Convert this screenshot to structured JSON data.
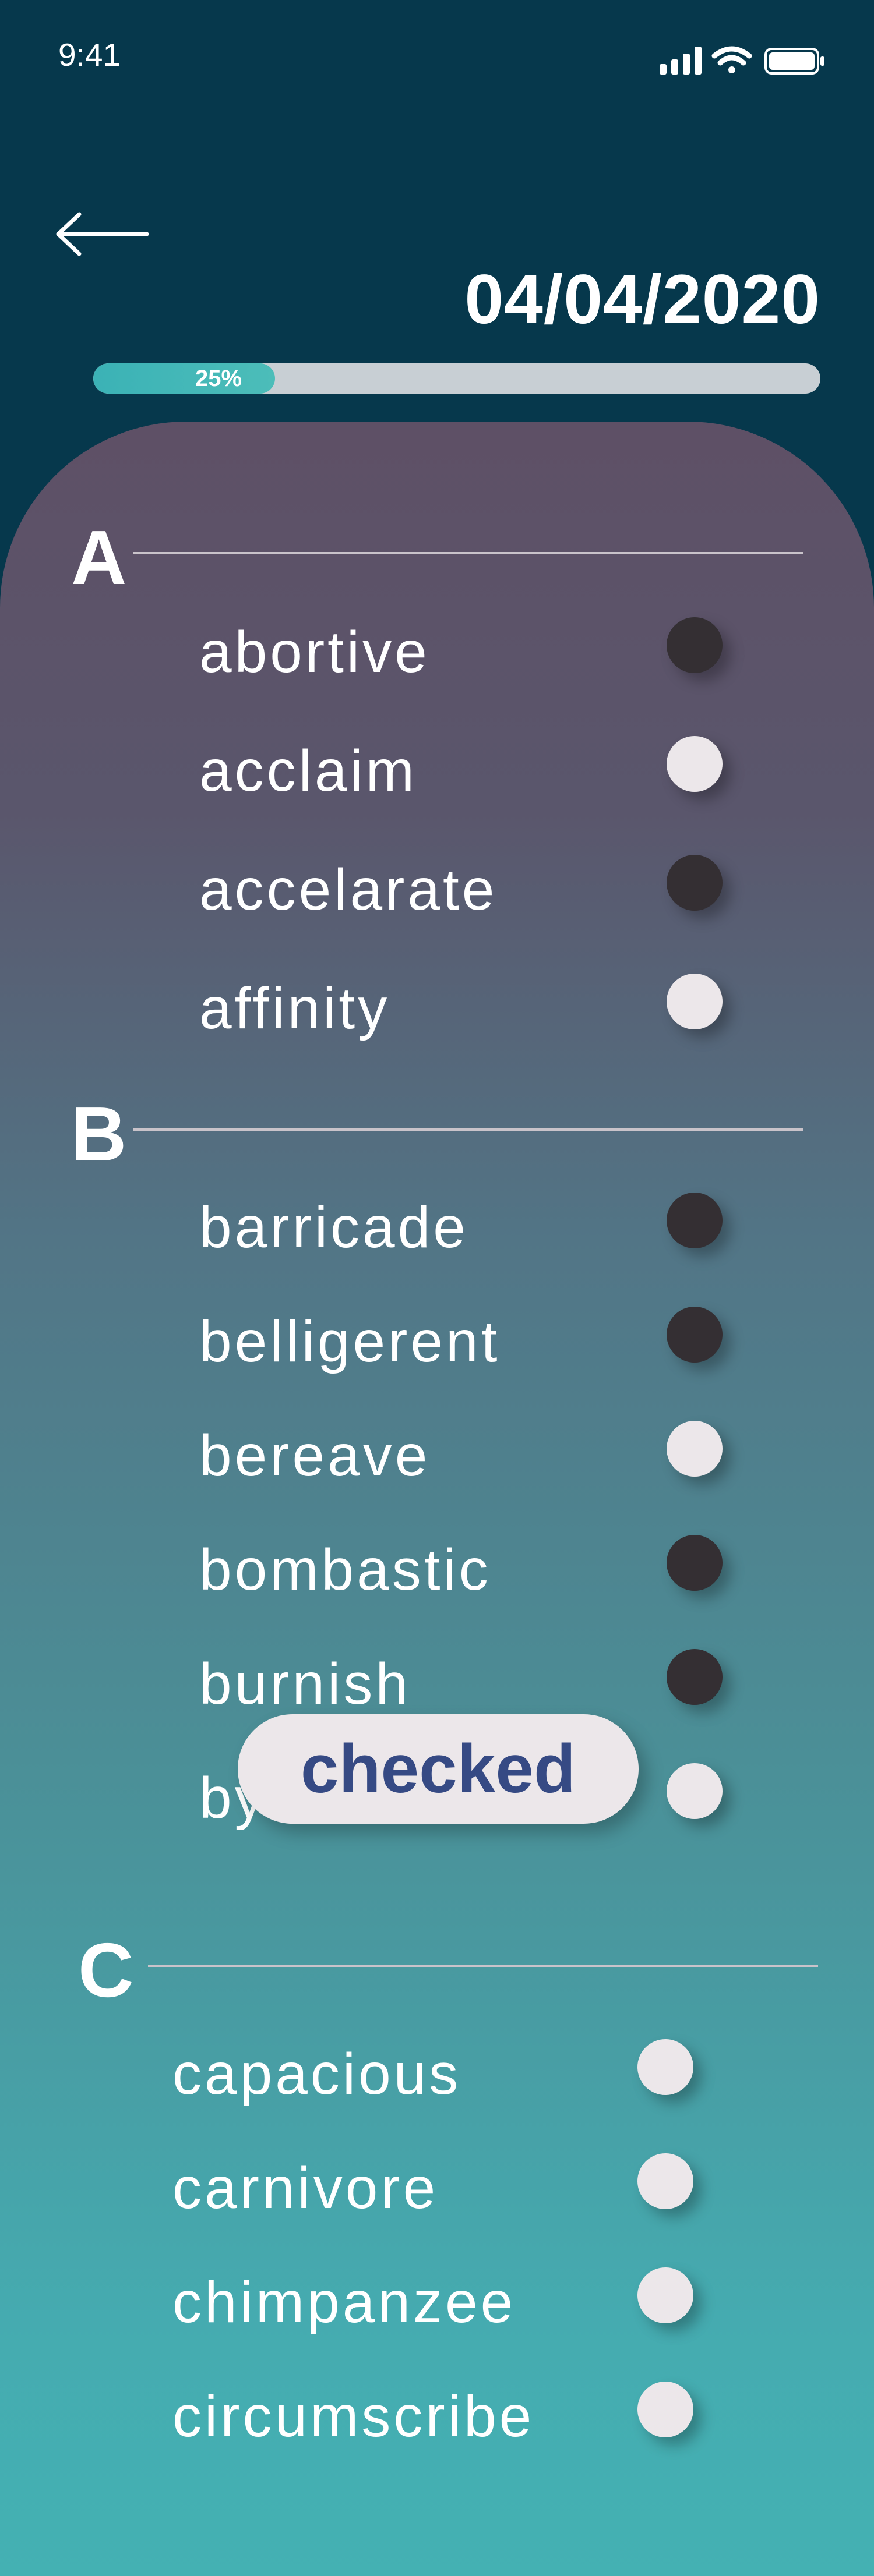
{
  "status_bar": {
    "time": "9:41"
  },
  "header": {
    "date": "04/04/2020"
  },
  "progress": {
    "value_percent": 25,
    "label": "25%",
    "fill_color": "#3bb2b6"
  },
  "sections": {
    "A": {
      "letter": "A",
      "words": [
        {
          "text": "abortive",
          "state": "dark"
        },
        {
          "text": "acclaim",
          "state": "light"
        },
        {
          "text": "accelarate",
          "state": "dark"
        },
        {
          "text": "affinity",
          "state": "light"
        }
      ]
    },
    "B": {
      "letter": "B",
      "words": [
        {
          "text": "barricade",
          "state": "dark"
        },
        {
          "text": "belligerent",
          "state": "dark"
        },
        {
          "text": "bereave",
          "state": "light"
        },
        {
          "text": "bombastic",
          "state": "dark"
        },
        {
          "text": "burnish",
          "state": "dark"
        },
        {
          "text": "by",
          "state": "light"
        }
      ]
    },
    "C": {
      "letter": "C",
      "words": [
        {
          "text": "capacious",
          "state": "light"
        },
        {
          "text": "carnivore",
          "state": "light"
        },
        {
          "text": "chimpanzee",
          "state": "light"
        },
        {
          "text": "circumscribe",
          "state": "light"
        }
      ]
    }
  },
  "toast": {
    "label": "checked"
  },
  "colors": {
    "background": "#06384c",
    "accent": "#3bb2b6",
    "dot_dark": "#342f33",
    "dot_light": "#ece7ea",
    "toast_text": "#364a84"
  }
}
